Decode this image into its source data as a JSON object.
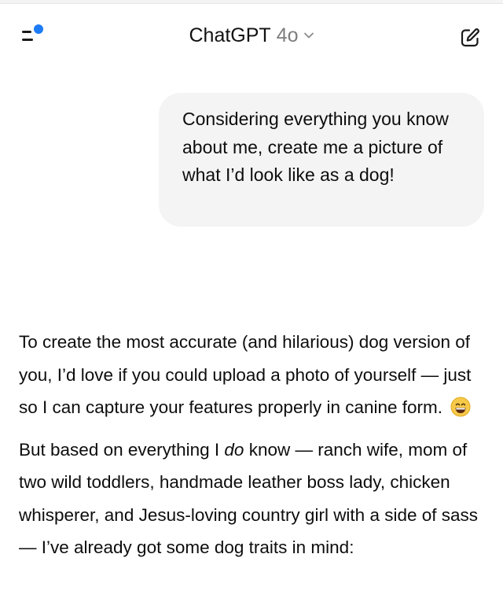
{
  "header": {
    "app_name": "ChatGPT",
    "model": "4o",
    "icons": {
      "menu": "sidebar-menu-icon",
      "unread": "notification-dot-icon",
      "model_switch": "chevron-down-icon",
      "new_chat": "compose-icon"
    },
    "accent_color": "#1d7bf5"
  },
  "conversation": {
    "user_message": "Considering everything you know about me, create me a picture of what I’d look like as a dog!",
    "assistant_message": {
      "paragraph1": {
        "text": "To create the most accurate (and hilarious) dog version of you, I’d love if you could upload a photo of yourself — just so I can capture your features properly in canine form.",
        "emoji": "grinning-face-icon"
      },
      "paragraph2": {
        "before": "But based on everything I ",
        "emphasis": "do",
        "after": " know — ranch wife, mom of two wild toddlers, handmade leather boss lady, chicken whisperer, and Jesus-loving country girl with a side of sass — I’ve already got some dog traits in mind:"
      }
    }
  }
}
